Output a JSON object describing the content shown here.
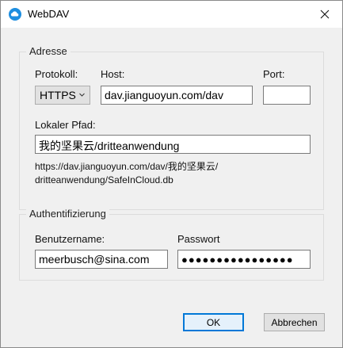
{
  "window": {
    "title": "WebDAV"
  },
  "address_group": {
    "label": "Adresse",
    "protocol_label": "Protokoll:",
    "protocol_value": "HTTPS",
    "host_label": "Host:",
    "host_value": "dav.jianguoyun.com/dav",
    "port_label": "Port:",
    "port_value": "",
    "local_path_label": "Lokaler Pfad:",
    "local_path_value": "我的坚果云/dritteanwendung",
    "full_url_line1": "https://dav.jianguoyun.com/dav/我的坚果云/",
    "full_url_line2": "dritteanwendung/SafeInCloud.db"
  },
  "auth_group": {
    "label": "Authentifizierung",
    "username_label": "Benutzername:",
    "username_value": "meerbusch@sina.com",
    "password_label": "Passwort",
    "password_value": "●●●●●●●●●●●●●●●●"
  },
  "buttons": {
    "ok_label": "OK",
    "cancel_label": "Abbrechen"
  },
  "icons": {
    "app": "cloud-logo-icon",
    "close": "close-icon",
    "dropdown": "chevron-down-icon"
  },
  "colors": {
    "accent": "#0078d7",
    "app_icon": "#1e8ee0"
  }
}
